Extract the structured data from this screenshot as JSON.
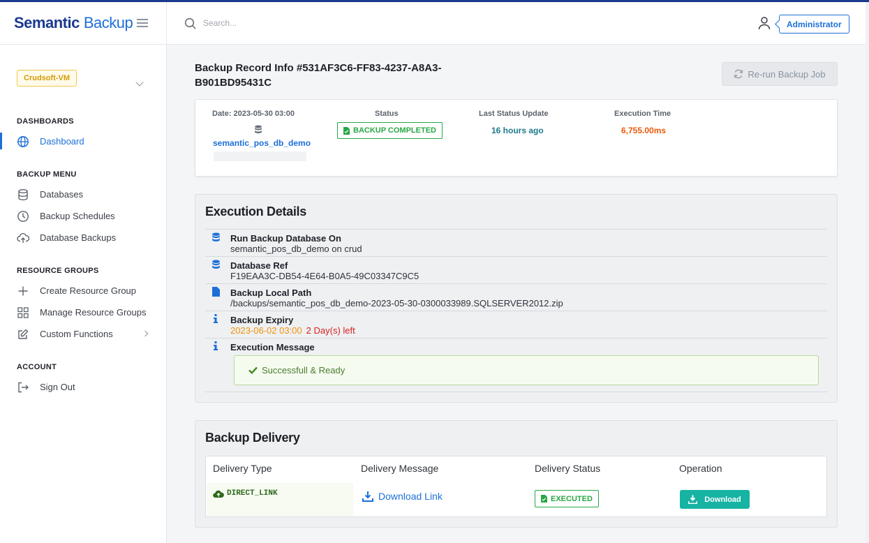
{
  "brand": {
    "part1": "Semantic",
    "part2": "Backup"
  },
  "sidebar": {
    "vm_label": "Crudsoft-VM",
    "sections": {
      "dashboards": "DASHBOARDS",
      "backup_menu": "BACKUP MENU",
      "resource_groups": "RESOURCE GROUPS",
      "account": "ACCOUNT"
    },
    "items": {
      "dashboard": "Dashboard",
      "databases": "Databases",
      "backup_schedules": "Backup Schedules",
      "database_backups": "Database Backups",
      "create_resource_group": "Create Resource Group",
      "manage_resource_groups": "Manage Resource Groups",
      "custom_functions": "Custom Functions",
      "sign_out": "Sign Out"
    }
  },
  "header": {
    "search_placeholder": "Search...",
    "user": "Administrator"
  },
  "record": {
    "title": "Backup Record Info #531AF3C6-FF83-4237-A8A3-B901BD95431C",
    "rerun_label": "Re-run Backup Job",
    "date_label": "Date: 2023-05-30 03:00",
    "database": "semantic_pos_db_demo",
    "status_label": "Status",
    "status_value": "BACKUP COMPLETED",
    "last_update_label": "Last Status Update",
    "last_update_value": "16 hours ago",
    "exec_time_label": "Execution Time",
    "exec_time_value": "6,755.00ms"
  },
  "execution": {
    "title": "Execution Details",
    "run_on_label": "Run Backup Database On",
    "run_on_value": "semantic_pos_db_demo on crud",
    "db_ref_label": "Database Ref",
    "db_ref_value": "F19EAA3C-DB54-4E64-B0A5-49C03347C9C5",
    "local_path_label": "Backup Local Path",
    "local_path_value": "/backups/semantic_pos_db_demo-2023-05-30-0300033989.SQLSERVER2012.zip",
    "expiry_label": "Backup Expiry",
    "expiry_date": "2023-06-02 03:00",
    "expiry_left": "2 Day(s) left",
    "message_label": "Execution Message",
    "message_value": "Successfull & Ready"
  },
  "delivery": {
    "title": "Backup Delivery",
    "columns": [
      "Delivery Type",
      "Delivery Message",
      "Delivery Status",
      "Operation"
    ],
    "type": "DIRECT_LINK",
    "message": "Download Link",
    "status": "EXECUTED",
    "operation": "Download"
  },
  "colors": {
    "brand_dark": "#1a3a8f",
    "accent": "#1d6fd8",
    "success": "#28a745",
    "teal": "#17b3a3",
    "orange": "#e8590c"
  }
}
